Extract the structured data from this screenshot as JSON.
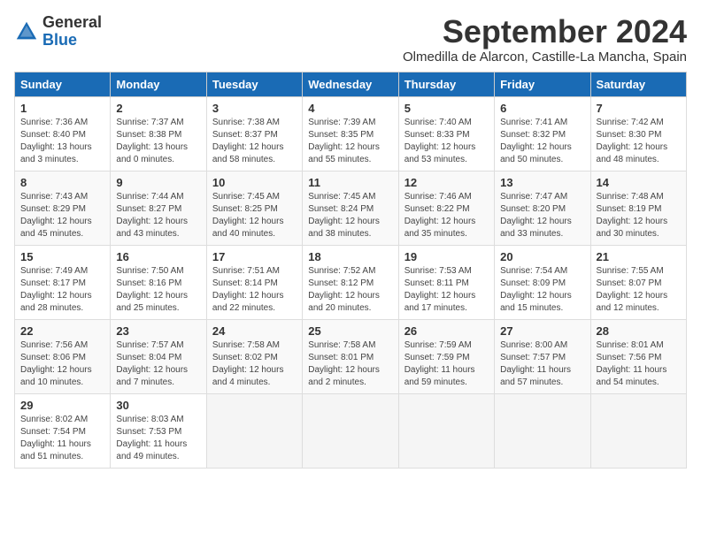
{
  "logo": {
    "general": "General",
    "blue": "Blue"
  },
  "title": "September 2024",
  "location": "Olmedilla de Alarcon, Castille-La Mancha, Spain",
  "days_of_week": [
    "Sunday",
    "Monday",
    "Tuesday",
    "Wednesday",
    "Thursday",
    "Friday",
    "Saturday"
  ],
  "weeks": [
    [
      {
        "day": "1",
        "info": "Sunrise: 7:36 AM\nSunset: 8:40 PM\nDaylight: 13 hours\nand 3 minutes."
      },
      {
        "day": "2",
        "info": "Sunrise: 7:37 AM\nSunset: 8:38 PM\nDaylight: 13 hours\nand 0 minutes."
      },
      {
        "day": "3",
        "info": "Sunrise: 7:38 AM\nSunset: 8:37 PM\nDaylight: 12 hours\nand 58 minutes."
      },
      {
        "day": "4",
        "info": "Sunrise: 7:39 AM\nSunset: 8:35 PM\nDaylight: 12 hours\nand 55 minutes."
      },
      {
        "day": "5",
        "info": "Sunrise: 7:40 AM\nSunset: 8:33 PM\nDaylight: 12 hours\nand 53 minutes."
      },
      {
        "day": "6",
        "info": "Sunrise: 7:41 AM\nSunset: 8:32 PM\nDaylight: 12 hours\nand 50 minutes."
      },
      {
        "day": "7",
        "info": "Sunrise: 7:42 AM\nSunset: 8:30 PM\nDaylight: 12 hours\nand 48 minutes."
      }
    ],
    [
      {
        "day": "8",
        "info": "Sunrise: 7:43 AM\nSunset: 8:29 PM\nDaylight: 12 hours\nand 45 minutes."
      },
      {
        "day": "9",
        "info": "Sunrise: 7:44 AM\nSunset: 8:27 PM\nDaylight: 12 hours\nand 43 minutes."
      },
      {
        "day": "10",
        "info": "Sunrise: 7:45 AM\nSunset: 8:25 PM\nDaylight: 12 hours\nand 40 minutes."
      },
      {
        "day": "11",
        "info": "Sunrise: 7:45 AM\nSunset: 8:24 PM\nDaylight: 12 hours\nand 38 minutes."
      },
      {
        "day": "12",
        "info": "Sunrise: 7:46 AM\nSunset: 8:22 PM\nDaylight: 12 hours\nand 35 minutes."
      },
      {
        "day": "13",
        "info": "Sunrise: 7:47 AM\nSunset: 8:20 PM\nDaylight: 12 hours\nand 33 minutes."
      },
      {
        "day": "14",
        "info": "Sunrise: 7:48 AM\nSunset: 8:19 PM\nDaylight: 12 hours\nand 30 minutes."
      }
    ],
    [
      {
        "day": "15",
        "info": "Sunrise: 7:49 AM\nSunset: 8:17 PM\nDaylight: 12 hours\nand 28 minutes."
      },
      {
        "day": "16",
        "info": "Sunrise: 7:50 AM\nSunset: 8:16 PM\nDaylight: 12 hours\nand 25 minutes."
      },
      {
        "day": "17",
        "info": "Sunrise: 7:51 AM\nSunset: 8:14 PM\nDaylight: 12 hours\nand 22 minutes."
      },
      {
        "day": "18",
        "info": "Sunrise: 7:52 AM\nSunset: 8:12 PM\nDaylight: 12 hours\nand 20 minutes."
      },
      {
        "day": "19",
        "info": "Sunrise: 7:53 AM\nSunset: 8:11 PM\nDaylight: 12 hours\nand 17 minutes."
      },
      {
        "day": "20",
        "info": "Sunrise: 7:54 AM\nSunset: 8:09 PM\nDaylight: 12 hours\nand 15 minutes."
      },
      {
        "day": "21",
        "info": "Sunrise: 7:55 AM\nSunset: 8:07 PM\nDaylight: 12 hours\nand 12 minutes."
      }
    ],
    [
      {
        "day": "22",
        "info": "Sunrise: 7:56 AM\nSunset: 8:06 PM\nDaylight: 12 hours\nand 10 minutes."
      },
      {
        "day": "23",
        "info": "Sunrise: 7:57 AM\nSunset: 8:04 PM\nDaylight: 12 hours\nand 7 minutes."
      },
      {
        "day": "24",
        "info": "Sunrise: 7:58 AM\nSunset: 8:02 PM\nDaylight: 12 hours\nand 4 minutes."
      },
      {
        "day": "25",
        "info": "Sunrise: 7:58 AM\nSunset: 8:01 PM\nDaylight: 12 hours\nand 2 minutes."
      },
      {
        "day": "26",
        "info": "Sunrise: 7:59 AM\nSunset: 7:59 PM\nDaylight: 11 hours\nand 59 minutes."
      },
      {
        "day": "27",
        "info": "Sunrise: 8:00 AM\nSunset: 7:57 PM\nDaylight: 11 hours\nand 57 minutes."
      },
      {
        "day": "28",
        "info": "Sunrise: 8:01 AM\nSunset: 7:56 PM\nDaylight: 11 hours\nand 54 minutes."
      }
    ],
    [
      {
        "day": "29",
        "info": "Sunrise: 8:02 AM\nSunset: 7:54 PM\nDaylight: 11 hours\nand 51 minutes."
      },
      {
        "day": "30",
        "info": "Sunrise: 8:03 AM\nSunset: 7:53 PM\nDaylight: 11 hours\nand 49 minutes."
      },
      {
        "day": "",
        "info": ""
      },
      {
        "day": "",
        "info": ""
      },
      {
        "day": "",
        "info": ""
      },
      {
        "day": "",
        "info": ""
      },
      {
        "day": "",
        "info": ""
      }
    ]
  ]
}
